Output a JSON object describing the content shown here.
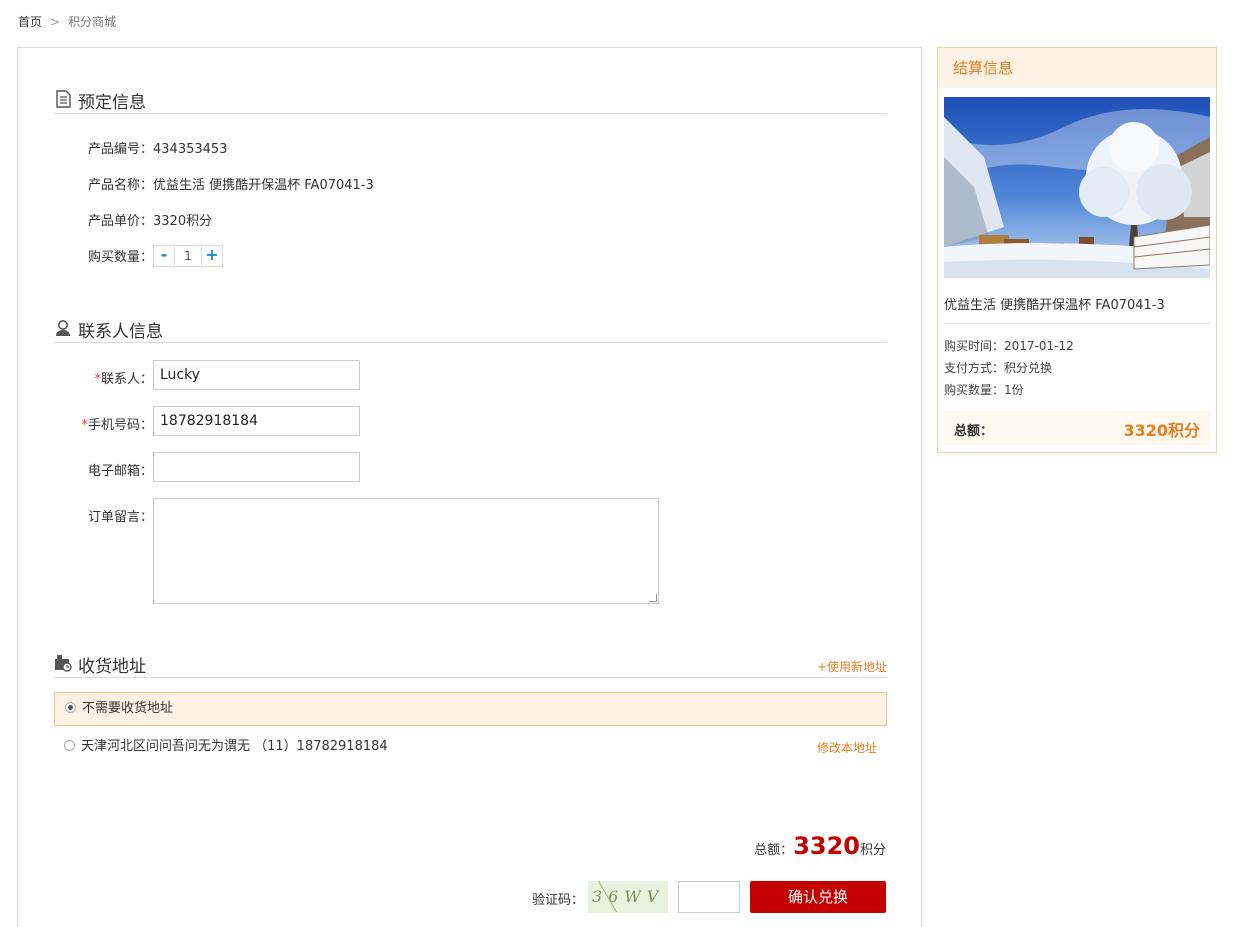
{
  "breadcrumb": {
    "home": "首页",
    "separator": ">",
    "current": "积分商城"
  },
  "booking": {
    "title": "预定信息",
    "product_code_label": "产品编号：",
    "product_code": "434353453",
    "product_name_label": "产品名称：",
    "product_name": "优益生活 便携酷开保温杯 FA07041-3",
    "unit_price_label": "产品单价：",
    "unit_price": "3320积分",
    "quantity_label": "购买数量：",
    "quantity_minus": "-",
    "quantity_value": "1",
    "quantity_plus": "+"
  },
  "contact": {
    "title": "联系人信息",
    "required_mark": "*",
    "name_label": "联系人：",
    "name_value": "Lucky",
    "phone_label": "手机号码：",
    "phone_value": "18782918184",
    "email_label": "电子邮箱：",
    "email_value": "",
    "note_label": "订单留言："
  },
  "address": {
    "title": "收货地址",
    "new_address_link": "+使用新地址",
    "options": [
      {
        "label": "不需要收货地址",
        "selected": true
      },
      {
        "label": "天津河北区问问吾问无为谓无 （11）18782918184",
        "selected": false,
        "edit_label": "修改本地址"
      }
    ]
  },
  "summary": {
    "total_label": "总额：",
    "total_value": "3320",
    "total_unit": "积分",
    "captcha_label": "验证码：",
    "captcha_text": "36WV",
    "confirm_button": "确认兑换"
  },
  "sidebar": {
    "title": "结算信息",
    "product_name": "优益生活 便携酷开保温杯 FA07041-3",
    "purchase_time": "购买时间：2017-01-12",
    "pay_method": "支付方式：积分兑换",
    "purchase_qty": "购买数量：1份",
    "total_label": "总额：",
    "total_value": "3320积分"
  },
  "colors": {
    "accent": "#e67e22",
    "primary_button": "#c40000",
    "total_red": "#c30000"
  }
}
